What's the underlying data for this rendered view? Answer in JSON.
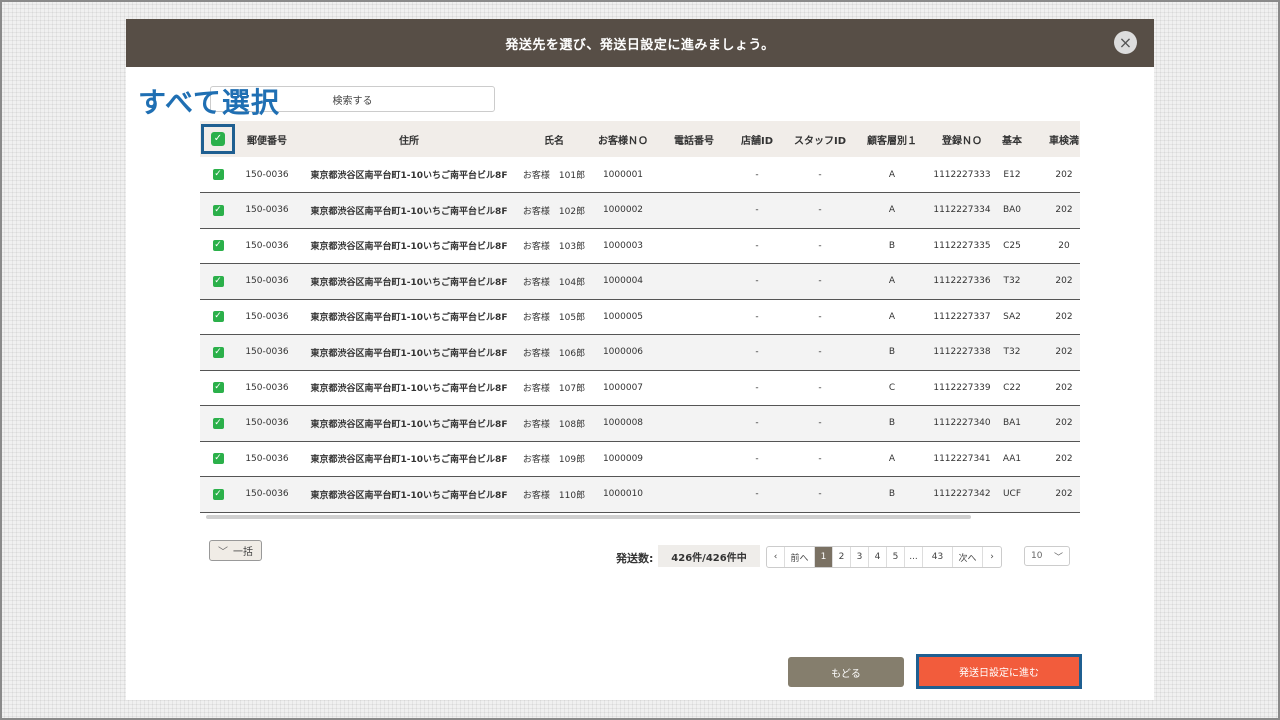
{
  "modal": {
    "title": "発送先を選び、発送日設定に進みましょう。",
    "close_icon": "×"
  },
  "callout": {
    "select_all": "すべて選択"
  },
  "search": {
    "label": "検索する"
  },
  "table": {
    "columns": [
      "郵便番号",
      "住所",
      "氏名",
      "お客様ＮＯ",
      "電話番号",
      "店舗ID",
      "スタッフID",
      "顧客層別１",
      "登録ＮＯ",
      "基本",
      "車検満"
    ],
    "rows": [
      {
        "zip": "150-0036",
        "address": "東京都渋谷区南平台町1-10いちご南平台ビル8F",
        "name": "お客様　101郎",
        "customer_no": "1000001",
        "phone": "",
        "store_id": "-",
        "staff_id": "-",
        "tier": "A",
        "reg_no": "1112227333",
        "basic": "E12",
        "inspection": "202"
      },
      {
        "zip": "150-0036",
        "address": "東京都渋谷区南平台町1-10いちご南平台ビル8F",
        "name": "お客様　102郎",
        "customer_no": "1000002",
        "phone": "",
        "store_id": "-",
        "staff_id": "-",
        "tier": "A",
        "reg_no": "1112227334",
        "basic": "BA0",
        "inspection": "202"
      },
      {
        "zip": "150-0036",
        "address": "東京都渋谷区南平台町1-10いちご南平台ビル8F",
        "name": "お客様　103郎",
        "customer_no": "1000003",
        "phone": "",
        "store_id": "-",
        "staff_id": "-",
        "tier": "B",
        "reg_no": "1112227335",
        "basic": "C25",
        "inspection": "20"
      },
      {
        "zip": "150-0036",
        "address": "東京都渋谷区南平台町1-10いちご南平台ビル8F",
        "name": "お客様　104郎",
        "customer_no": "1000004",
        "phone": "",
        "store_id": "-",
        "staff_id": "-",
        "tier": "A",
        "reg_no": "1112227336",
        "basic": "T32",
        "inspection": "202"
      },
      {
        "zip": "150-0036",
        "address": "東京都渋谷区南平台町1-10いちご南平台ビル8F",
        "name": "お客様　105郎",
        "customer_no": "1000005",
        "phone": "",
        "store_id": "-",
        "staff_id": "-",
        "tier": "A",
        "reg_no": "1112227337",
        "basic": "SA2",
        "inspection": "202"
      },
      {
        "zip": "150-0036",
        "address": "東京都渋谷区南平台町1-10いちご南平台ビル8F",
        "name": "お客様　106郎",
        "customer_no": "1000006",
        "phone": "",
        "store_id": "-",
        "staff_id": "-",
        "tier": "B",
        "reg_no": "1112227338",
        "basic": "T32",
        "inspection": "202"
      },
      {
        "zip": "150-0036",
        "address": "東京都渋谷区南平台町1-10いちご南平台ビル8F",
        "name": "お客様　107郎",
        "customer_no": "1000007",
        "phone": "",
        "store_id": "-",
        "staff_id": "-",
        "tier": "C",
        "reg_no": "1112227339",
        "basic": "C22",
        "inspection": "202"
      },
      {
        "zip": "150-0036",
        "address": "東京都渋谷区南平台町1-10いちご南平台ビル8F",
        "name": "お客様　108郎",
        "customer_no": "1000008",
        "phone": "",
        "store_id": "-",
        "staff_id": "-",
        "tier": "B",
        "reg_no": "1112227340",
        "basic": "BA1",
        "inspection": "202"
      },
      {
        "zip": "150-0036",
        "address": "東京都渋谷区南平台町1-10いちご南平台ビル8F",
        "name": "お客様　109郎",
        "customer_no": "1000009",
        "phone": "",
        "store_id": "-",
        "staff_id": "-",
        "tier": "A",
        "reg_no": "1112227341",
        "basic": "AA1",
        "inspection": "202"
      },
      {
        "zip": "150-0036",
        "address": "東京都渋谷区南平台町1-10いちご南平台ビル8F",
        "name": "お客様　110郎",
        "customer_no": "1000010",
        "phone": "",
        "store_id": "-",
        "staff_id": "-",
        "tier": "B",
        "reg_no": "1112227342",
        "basic": "UCF",
        "inspection": "202"
      }
    ]
  },
  "bulk": {
    "label": "一括",
    "icon": "chevron-down-icon"
  },
  "shipping": {
    "label": "発送数:",
    "count": "426件/426件中"
  },
  "pagination": {
    "prev_icon": "‹",
    "prev_label": "前へ",
    "pages": [
      "1",
      "2",
      "3",
      "4",
      "5"
    ],
    "current": "1",
    "ellipsis": "...",
    "last": "43",
    "next_label": "次へ",
    "next_icon": "›",
    "per_page": "10"
  },
  "actions": {
    "back_label": "もどる",
    "next_label": "発送日設定に進む"
  },
  "colors": {
    "header_bg": "#574e46",
    "checkbox": "#2bb04a",
    "highlight_outline": "#1f5f91",
    "primary_button": "#f25c3c",
    "secondary_button": "#857e6d"
  }
}
